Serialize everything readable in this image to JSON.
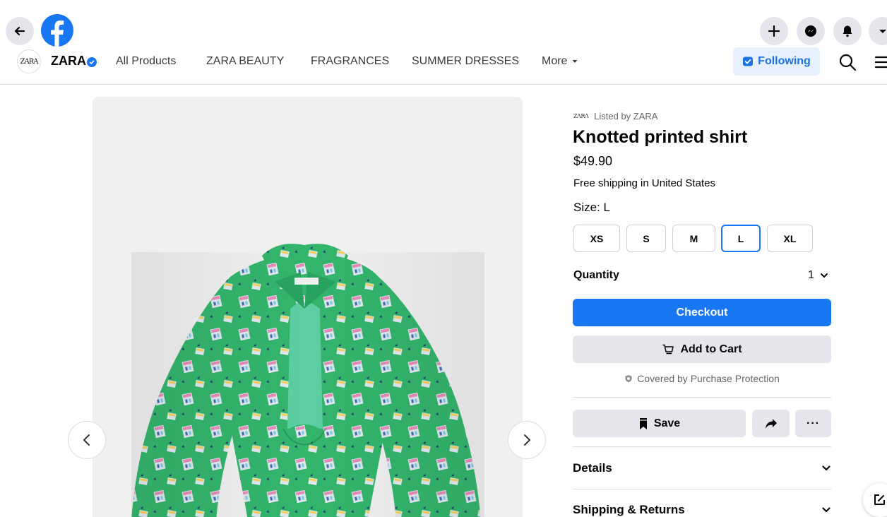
{
  "header": {
    "back_icon": "back-arrow-icon",
    "logo": "facebook-logo",
    "actions": [
      "plus-icon",
      "messenger-icon",
      "bell-icon",
      "caret-down-icon"
    ]
  },
  "shop": {
    "logo_text": "ZARA",
    "name": "ZARA",
    "verified": true,
    "nav": [
      "All Products",
      "ZARA BEAUTY",
      "FRAGRANCES",
      "SUMMER DRESSES",
      "More"
    ],
    "following_label": "Following"
  },
  "product": {
    "listed_by": "Listed by ZARA",
    "title": "Knotted printed shirt",
    "price": "$49.90",
    "shipping": "Free shipping in United States",
    "size_label": "Size: L",
    "sizes": [
      "XS",
      "S",
      "M",
      "L",
      "XL"
    ],
    "selected_size": "L",
    "quantity_label": "Quantity",
    "quantity_value": "1",
    "checkout_label": "Checkout",
    "add_to_cart_label": "Add to Cart",
    "protection_text": "Covered by Purchase Protection",
    "save_label": "Save",
    "more_label": "···",
    "details_label": "Details",
    "shipping_returns_label": "Shipping & Returns"
  },
  "colors": {
    "accent": "#1877f2",
    "button_gray": "#e4e6eb",
    "following_bg": "#e7f0fd",
    "shirt_green": "#2fb56a"
  }
}
